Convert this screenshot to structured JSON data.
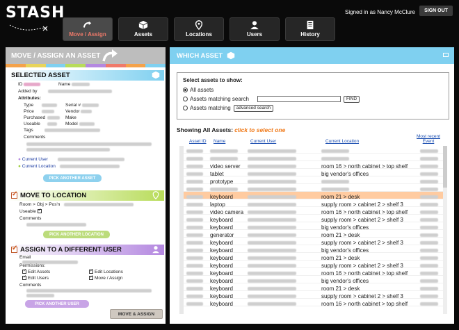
{
  "app": {
    "logo": "STASH",
    "signed_in": "Signed in as Nancy McClure",
    "sign_out": "SIGN OUT"
  },
  "nav": [
    {
      "label": "Move / Assign",
      "icon": "arrow-curve-icon",
      "active": true
    },
    {
      "label": "Assets",
      "icon": "cube-icon",
      "active": false
    },
    {
      "label": "Locations",
      "icon": "pin-icon",
      "active": false
    },
    {
      "label": "Users",
      "icon": "user-icon",
      "active": false
    },
    {
      "label": "History",
      "icon": "list-icon",
      "active": false
    }
  ],
  "colors": {
    "blue": "#7fd0f0",
    "green": "#b8dc5a",
    "purple": "#b488e0",
    "orange": "#f07a1a",
    "highlight": "#ffcba0"
  },
  "left": {
    "title": "MOVE / ASSIGN AN ASSET",
    "selected": {
      "heading": "SELECTED ASSET",
      "id_label": "ID",
      "name_label": "Name",
      "added_by": "Added by",
      "attributes": "Attributes:",
      "type": "Type",
      "serial": "Serial #",
      "price": "Price",
      "vendor": "Vendor",
      "purchased": "Purchased",
      "make": "Make",
      "useable": "Useable",
      "model": "Model",
      "tags": "Tags",
      "comments": "Comments",
      "current_user": "Current User",
      "current_location": "Current Location",
      "pick_button": "PICK ANOTHER ASSET"
    },
    "move": {
      "heading": "MOVE TO LOCATION",
      "room_label": "Room > Obj > Pos'n",
      "useable": "Useable",
      "comments": "Comments",
      "pick_button": "PICK ANOTHER LOCATION"
    },
    "assign": {
      "heading": "ASSIGN TO A DIFFERENT USER",
      "email": "Email",
      "permissions": "Permissions:",
      "perm_edit_assets": "Edit Assets",
      "perm_edit_locations": "Edit Locations",
      "perm_edit_users": "Edit Users",
      "perm_move_assign": "Move / Assign",
      "comments": "Comments",
      "pick_button": "PICK ANOTHER USER"
    },
    "submit": "MOVE & ASSIGN"
  },
  "right": {
    "title": "WHICH ASSET",
    "select_title": "Select assets to show:",
    "opt_all": "All assets",
    "opt_search": "Assets matching search",
    "find": "FIND",
    "opt_matching": "Assets matching",
    "advanced": "advanced search",
    "showing": "Showing All Assets:",
    "hint": "click to select one",
    "columns": {
      "id": "Asset ID",
      "name": "Name",
      "user": "Current User",
      "location": "Current Location",
      "event": "Most recent Event"
    },
    "rows": [
      {
        "name": "",
        "user": "",
        "loc": ""
      },
      {
        "name": "",
        "user": "",
        "loc": ""
      },
      {
        "name": "video server",
        "user": "",
        "loc": "room 16 > north cabinet > top shelf"
      },
      {
        "name": "tablet",
        "user": "",
        "loc": "big vendor's offices"
      },
      {
        "name": "prototype",
        "user": "",
        "loc": ""
      },
      {
        "name": "",
        "user": "",
        "loc": ""
      },
      {
        "name": "keyboard",
        "user": "",
        "loc": "room 21 > desk",
        "hl": true
      },
      {
        "name": "laptop",
        "user": "",
        "loc": "supply room > cabinet 2 > shelf 3"
      },
      {
        "name": "video camera",
        "user": "",
        "loc": "room 16 > north cabinet > top shelf"
      },
      {
        "name": "keyboard",
        "user": "",
        "loc": "supply room > cabinet 2 > shelf 3"
      },
      {
        "name": "keyboard",
        "user": "",
        "loc": "big vendor's offices"
      },
      {
        "name": "generator",
        "user": "",
        "loc": "room 21 > desk"
      },
      {
        "name": "keyboard",
        "user": "",
        "loc": "supply room > cabinet 2 > shelf 3"
      },
      {
        "name": "keyboard",
        "user": "",
        "loc": "big vendor's offices"
      },
      {
        "name": "keyboard",
        "user": "",
        "loc": "room 21 > desk"
      },
      {
        "name": "keyboard",
        "user": "",
        "loc": "supply room > cabinet 2 > shelf 3"
      },
      {
        "name": "keyboard",
        "user": "",
        "loc": "room 16 > north cabinet > top shelf"
      },
      {
        "name": "keyboard",
        "user": "",
        "loc": "big vendor's offices"
      },
      {
        "name": "keyboard",
        "user": "",
        "loc": "room 21 > desk"
      },
      {
        "name": "keyboard",
        "user": "",
        "loc": "supply room > cabinet 2 > shelf 3"
      },
      {
        "name": "keyboard",
        "user": "",
        "loc": "room 16 > north cabinet > top shelf"
      }
    ]
  }
}
